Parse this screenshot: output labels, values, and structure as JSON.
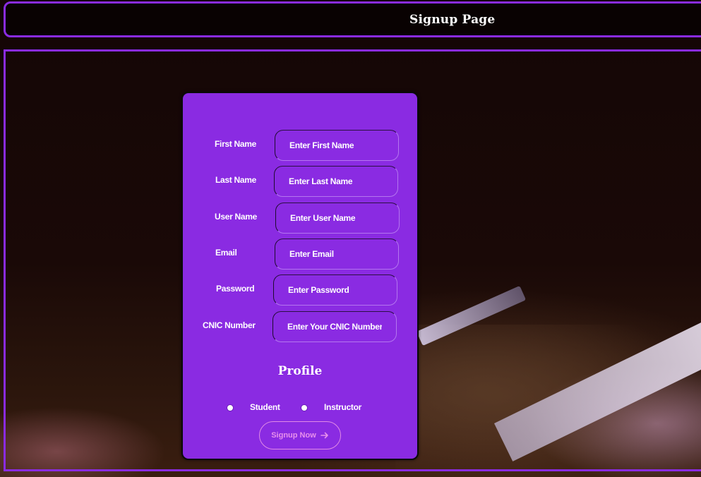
{
  "header": {
    "title": "Signup Page"
  },
  "form": {
    "fields": [
      {
        "label": "First Name",
        "placeholder": "Enter First Name"
      },
      {
        "label": "Last Name",
        "placeholder": "Enter Last Name"
      },
      {
        "label": "User Name",
        "placeholder": "Enter User Name"
      },
      {
        "label": "Email",
        "placeholder": "Enter Email"
      },
      {
        "label": "Password",
        "placeholder": "Enter Password"
      },
      {
        "label": "CNIC Number",
        "placeholder": "Enter Your CNIC Number"
      }
    ],
    "profile_title": "Profile",
    "profile_options": [
      "Student",
      "Instructor"
    ],
    "submit_label": "Signup Now",
    "submit_icon": "arrow-right-icon"
  },
  "colors": {
    "accent": "#8a2be2",
    "text": "#ffffff",
    "button_text": "#e890ec"
  }
}
